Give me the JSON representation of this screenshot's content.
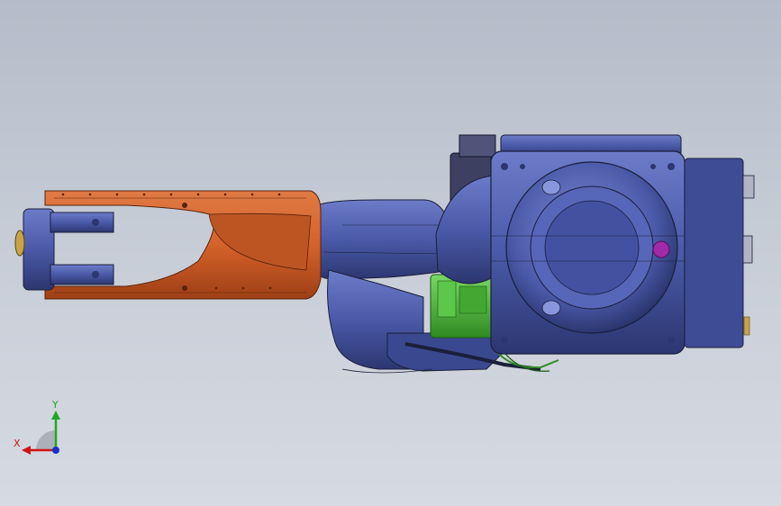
{
  "viewport": {
    "background_top": "#b5bcc9",
    "background_bottom": "#d6dae2"
  },
  "model": {
    "colors": {
      "forearm_orange": "#d4622a",
      "forearm_orange_dark": "#9e3f15",
      "body_blue": "#4a5aa8",
      "body_blue_dark": "#2c3670",
      "body_blue_light": "#6c7cc8",
      "gear_green": "#4fbf3c",
      "marker_magenta": "#a02aa8",
      "outline": "#1a1f3a"
    }
  },
  "triad": {
    "x_label": "X",
    "y_label": "Y",
    "x_color": "#d01515",
    "y_color": "#1fa81f",
    "z_color": "#1530d0"
  }
}
